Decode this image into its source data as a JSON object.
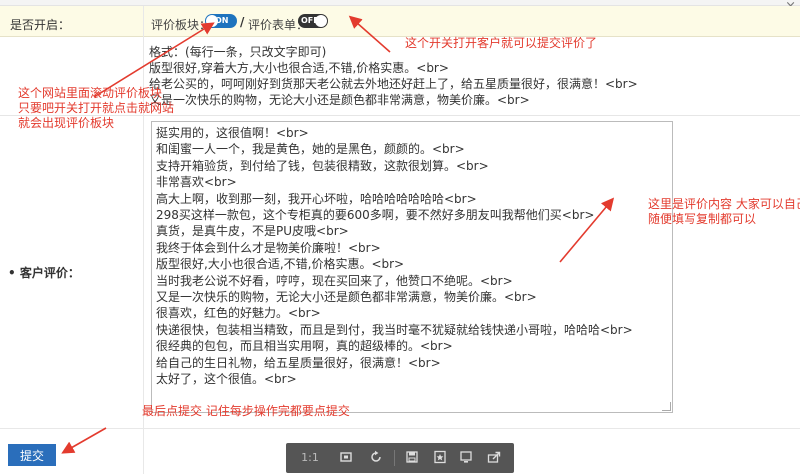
{
  "window": {
    "close_glyph": "×"
  },
  "settings": {
    "enable_label": "是否开启：",
    "block_label": "评价板块：",
    "block_toggle": "ON",
    "form_label": "评价表单：",
    "form_toggle": "OFF",
    "slash": "/"
  },
  "format": {
    "lines": [
      "格式：(每行一条，只改文字即可)",
      "版型很好,穿着大方,大小也很合适,不错,价格实惠。<br>",
      "给老公买的，呵呵刚好到货那天老公就去外地还好赶上了，给五星质量很好，很满意！<br>",
      "又是一次快乐的购物，无论大小还是颜色都非常满意，物美价廉。<br>"
    ]
  },
  "review": {
    "label": "• 客户评价：",
    "lines": [
      "挺实用的，这很值啊！<br>",
      "和闺蜜一人一个，我是黄色，她的是黑色，颜颜的。<br>",
      "支持开箱验货，到付给了钱，包装很精致，这款很划算。<br>",
      "非常喜欢<br>",
      "高大上啊，收到那一刻，我开心坏啦，哈哈哈哈哈哈哈<br>",
      "298买这样一款包，这个专柜真的要600多啊，要不然好多朋友叫我帮他们买<br>",
      "真货，是真牛皮，不是PU皮哦<br>",
      "我终于体会到什么才是物美价廉啦！<br>",
      "版型很好,大小也很合适,不错,价格实惠。<br>",
      "当时我老公说不好看，哼哼，现在买回来了，他赞口不绝呢。<br>",
      "又是一次快乐的购物，无论大小还是颜色都非常满意，物美价廉。<br>",
      "很喜欢，红色的好魅力。<br>",
      "快递很快，包装相当精致，而且是到付，我当时毫不犹疑就给钱快递小哥啦，哈哈哈<br>",
      "很经典的包包，而且相当实用啊，真的超级棒的。<br>",
      "给自己的生日礼物，给五星质量很好，很满意！<br>",
      "太好了，这个很值。<br>"
    ]
  },
  "submit_label": "提交",
  "viewer": {
    "ratio": "1:1"
  },
  "annotations": {
    "switch_note": "这个开关打开客户就可以提交评价了",
    "website_note_1": "这个网站里面滚动评价板块",
    "website_note_2": "只要吧开关打开就点击就网站",
    "website_note_3": "就会出现评价板块",
    "content_note_1": "这里是评价内容 大家可以自己",
    "content_note_2": "随便填写复制都可以",
    "submit_note": "最后点提交  记住每步操作完都要点提交"
  },
  "colors": {
    "accent": "#1e73be",
    "annotation": "#e33b2e",
    "header_bg": "#fdfbe6",
    "button": "#2a6ebb"
  }
}
